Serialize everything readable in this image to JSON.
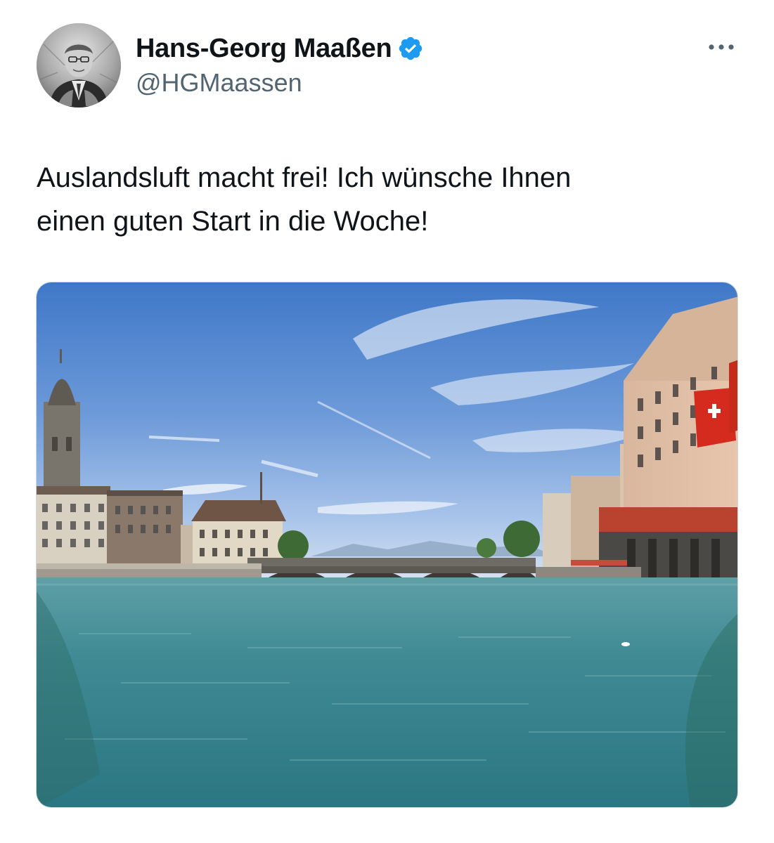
{
  "author": {
    "display_name": "Hans-Georg Maaßen",
    "handle": "@HGMaassen",
    "verified": true,
    "avatar_icon": "profile-photo"
  },
  "more_icon": "more-horizontal-icon",
  "tweet": {
    "text": "Auslandsluft macht frei! Ich wünsche Ihnen\neinen guten Start in die Woche!"
  },
  "media": {
    "type": "photo",
    "icon": "river-city-photo"
  },
  "colors": {
    "text": "#0f1419",
    "secondary_text": "#536471",
    "verified_badge": "#1d9bf0",
    "border": "#cfd9de"
  }
}
